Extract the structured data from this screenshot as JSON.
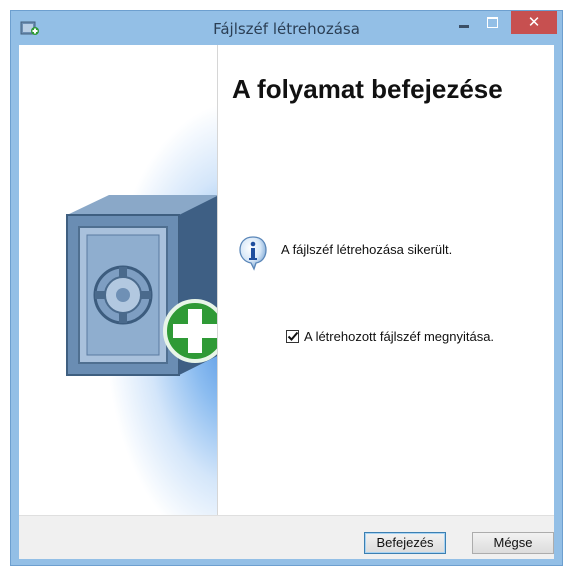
{
  "window": {
    "title": "Fájlszéf létrehozása",
    "close_glyph": "✕"
  },
  "icons": {
    "app": "safe-app-icon",
    "info": "info-icon",
    "safe": "safe-illustration-icon",
    "plus": "green-plus-icon"
  },
  "main": {
    "heading": "A folyamat befejezése",
    "status": "A fájlszéf létrehozása sikerült.",
    "open_checkbox": {
      "label": "A létrehozott fájlszéf megnyitása.",
      "checked": true
    }
  },
  "footer": {
    "finish_label": "Befejezés",
    "cancel_label": "Mégse"
  },
  "colors": {
    "titlebar": "#93bfe6",
    "close_button": "#c75050",
    "plus_green": "#2f9a36"
  }
}
